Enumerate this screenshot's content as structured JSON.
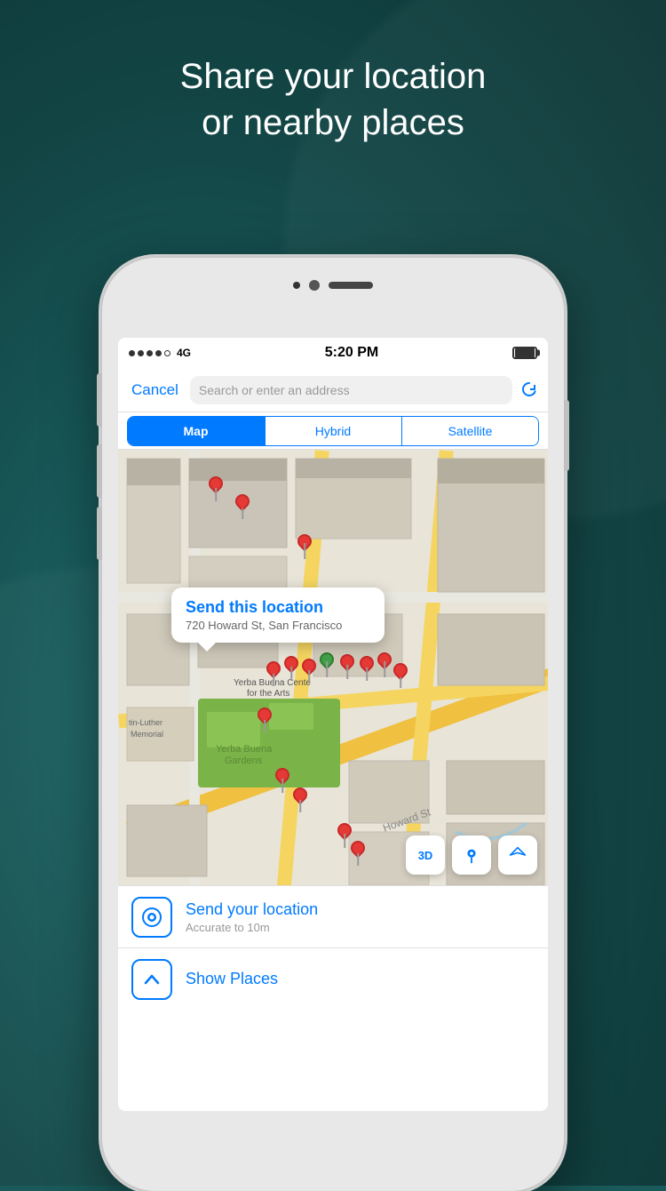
{
  "background": {
    "color": "#1a5a5a"
  },
  "header": {
    "title_line1": "Share your location",
    "title_line2": "or nearby places"
  },
  "status_bar": {
    "signal_bars": 4,
    "network": "4G",
    "time": "5:20 PM",
    "battery_full": true
  },
  "toolbar": {
    "cancel_label": "Cancel",
    "search_placeholder": "Search or enter an address"
  },
  "map_type_selector": {
    "options": [
      "Map",
      "Hybrid",
      "Satellite"
    ],
    "active": "Map"
  },
  "map": {
    "popup": {
      "title": "Send this location",
      "address": "720 Howard St, San Francisco"
    },
    "road_label": "Howard St",
    "controls": {
      "threed": "3D",
      "pin_icon": "📍",
      "location_icon": "➤"
    }
  },
  "list_items": [
    {
      "id": "send-location",
      "title": "Send your location",
      "subtitle": "Accurate to 10m",
      "icon_type": "location-dot"
    },
    {
      "id": "show-places",
      "title": "Show Places",
      "subtitle": "",
      "icon_type": "chevron-up"
    }
  ]
}
